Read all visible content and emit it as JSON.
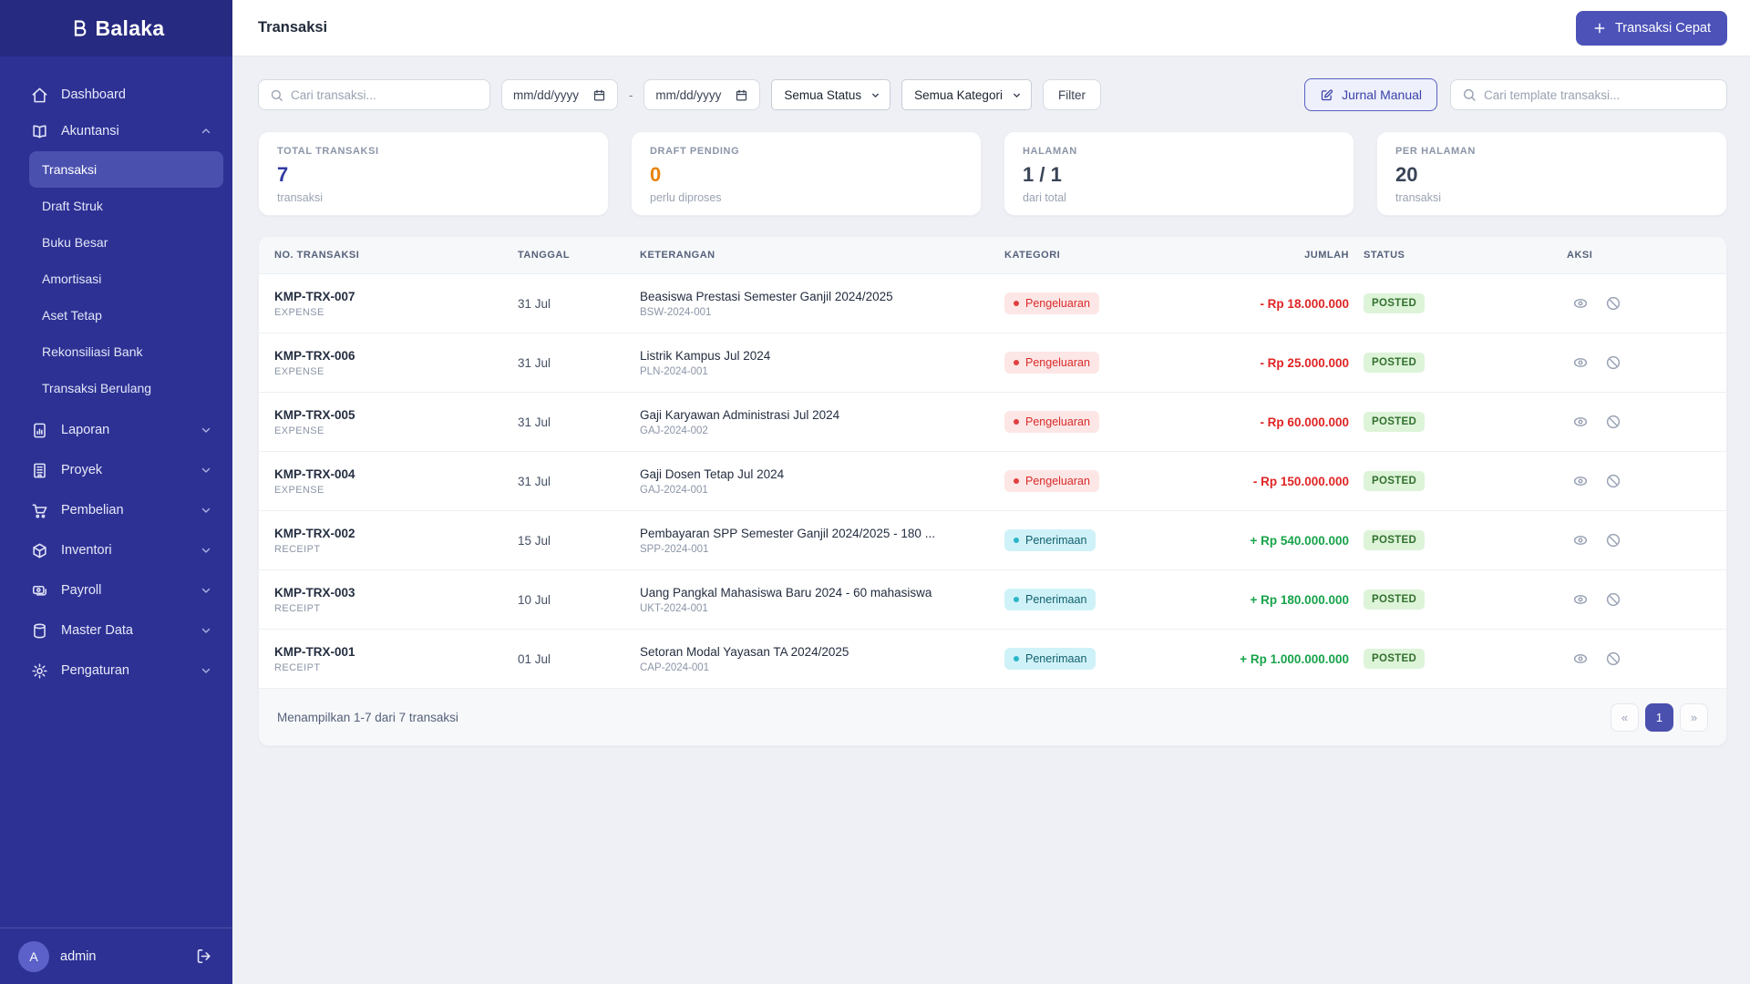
{
  "brand": {
    "name": "Balaka"
  },
  "sidebar": {
    "items": [
      "Dashboard",
      "Akuntansi",
      "Laporan",
      "Proyek",
      "Pembelian",
      "Inventori",
      "Payroll",
      "Master Data",
      "Pengaturan"
    ],
    "akuntansi_sub": [
      "Transaksi",
      "Draft Struk",
      "Buku Besar",
      "Amortisasi",
      "Aset Tetap",
      "Rekonsiliasi Bank",
      "Transaksi Berulang"
    ],
    "active_item": "Transaksi",
    "user": {
      "initial": "A",
      "name": "admin"
    }
  },
  "header": {
    "title": "Transaksi",
    "quick_action": "Transaksi Cepat"
  },
  "filters": {
    "search_placeholder": "Cari transaksi...",
    "date_from": "mm/dd/yyyy",
    "date_to": "mm/dd/yyyy",
    "date_separator": "-",
    "status_select": "Semua Status",
    "category_select": "Semua Kategori",
    "filter_button": "Filter",
    "journal_button": "Jurnal Manual",
    "template_search_placeholder": "Cari template transaksi..."
  },
  "stats": [
    {
      "label": "TOTAL TRANSAKSI",
      "value": "7",
      "sub": "transaksi"
    },
    {
      "label": "DRAFT PENDING",
      "value": "0",
      "sub": "perlu diproses"
    },
    {
      "label": "HALAMAN",
      "value": "1 / 1",
      "sub": "dari total"
    },
    {
      "label": "PER HALAMAN",
      "value": "20",
      "sub": "transaksi"
    }
  ],
  "table": {
    "columns": [
      "NO. TRANSAKSI",
      "TANGGAL",
      "KETERANGAN",
      "KATEGORI",
      "JUMLAH",
      "STATUS",
      "AKSI"
    ],
    "rows": [
      {
        "no": "KMP-TRX-007",
        "type": "EXPENSE",
        "date": "31 Jul",
        "desc": "Beasiswa Prestasi Semester Ganjil 2024/2025",
        "ref": "BSW-2024-001",
        "category": "Pengeluaran",
        "amount": "- Rp 18.000.000",
        "status": "POSTED"
      },
      {
        "no": "KMP-TRX-006",
        "type": "EXPENSE",
        "date": "31 Jul",
        "desc": "Listrik Kampus Jul 2024",
        "ref": "PLN-2024-001",
        "category": "Pengeluaran",
        "amount": "- Rp 25.000.000",
        "status": "POSTED"
      },
      {
        "no": "KMP-TRX-005",
        "type": "EXPENSE",
        "date": "31 Jul",
        "desc": "Gaji Karyawan Administrasi Jul 2024",
        "ref": "GAJ-2024-002",
        "category": "Pengeluaran",
        "amount": "- Rp 60.000.000",
        "status": "POSTED"
      },
      {
        "no": "KMP-TRX-004",
        "type": "EXPENSE",
        "date": "31 Jul",
        "desc": "Gaji Dosen Tetap Jul 2024",
        "ref": "GAJ-2024-001",
        "category": "Pengeluaran",
        "amount": "- Rp 150.000.000",
        "status": "POSTED"
      },
      {
        "no": "KMP-TRX-002",
        "type": "RECEIPT",
        "date": "15 Jul",
        "desc": "Pembayaran SPP Semester Ganjil 2024/2025 - 180 ...",
        "ref": "SPP-2024-001",
        "category": "Penerimaan",
        "amount": "+ Rp 540.000.000",
        "status": "POSTED"
      },
      {
        "no": "KMP-TRX-003",
        "type": "RECEIPT",
        "date": "10 Jul",
        "desc": "Uang Pangkal Mahasiswa Baru 2024 - 60 mahasiswa",
        "ref": "UKT-2024-001",
        "category": "Penerimaan",
        "amount": "+ Rp 180.000.000",
        "status": "POSTED"
      },
      {
        "no": "KMP-TRX-001",
        "type": "RECEIPT",
        "date": "01 Jul",
        "desc": "Setoran Modal Yayasan TA 2024/2025",
        "ref": "CAP-2024-001",
        "category": "Penerimaan",
        "amount": "+ Rp 1.000.000.000",
        "status": "POSTED"
      }
    ]
  },
  "footer": {
    "summary": "Menampilkan 1-7 dari 7 transaksi",
    "prev": "«",
    "page": "1",
    "next": "»"
  },
  "colors": {
    "sidebar": "#2d3194",
    "accent": "#4c52b8",
    "negative": "#e02424",
    "positive": "#17a34a",
    "warning": "#e8830d",
    "badge_out_bg": "#fde6e6",
    "badge_in_bg": "#cff2f8",
    "status_posted_bg": "#ddf4d9"
  }
}
